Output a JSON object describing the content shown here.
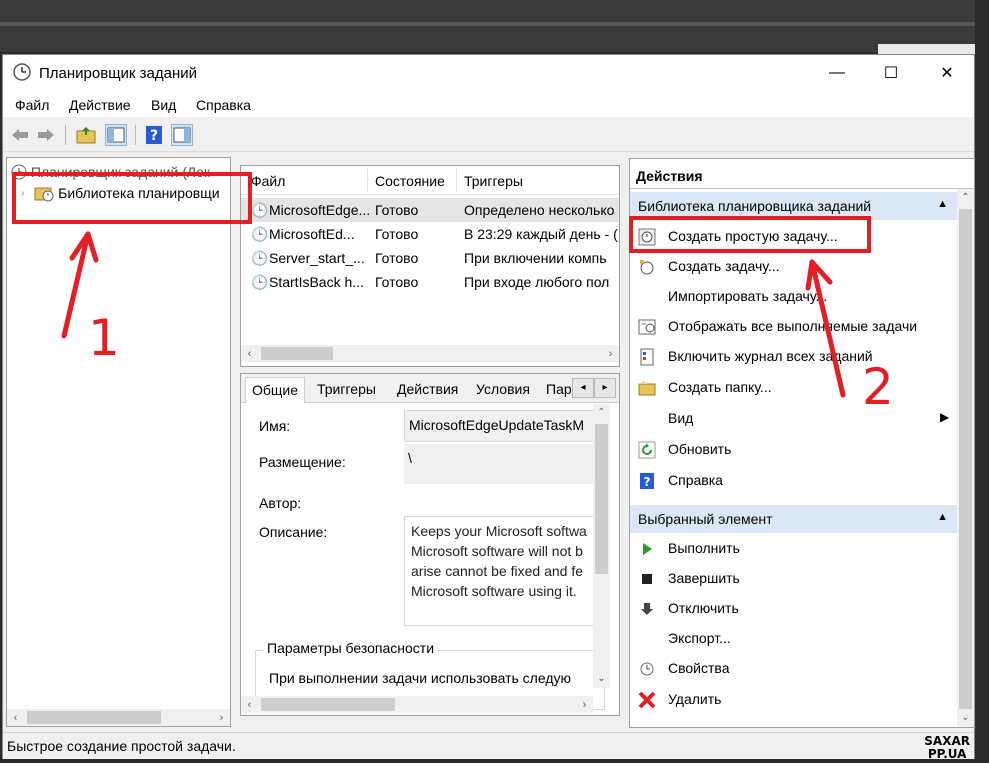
{
  "window": {
    "title": "Планировщик заданий",
    "minimize": "—",
    "maximize": "☐",
    "close": "✕"
  },
  "menu": [
    "Файл",
    "Действие",
    "Вид",
    "Справка"
  ],
  "tree": {
    "root": "Планировщик заданий (Лок",
    "library": "Библиотека планировщи"
  },
  "tasks": {
    "columns": [
      "Файл",
      "Состояние",
      "Триггеры"
    ],
    "rows": [
      {
        "name": "MicrosoftEdge...",
        "state": "Готово",
        "trigger": "Определено несколько"
      },
      {
        "name": "MicrosoftEd...",
        "state": "Готово",
        "trigger": "В 23:29 каждый день - ("
      },
      {
        "name": "Server_start_...",
        "state": "Готово",
        "trigger": "При включении компь"
      },
      {
        "name": "StartIsBack h...",
        "state": "Готово",
        "trigger": "При входе любого пол"
      }
    ]
  },
  "details": {
    "tabs": [
      "Общие",
      "Триггеры",
      "Действия",
      "Условия",
      "Пар"
    ],
    "name_label": "Имя:",
    "name_value": "MicrosoftEdgeUpdateTaskM",
    "location_label": "Размещение:",
    "location_value": "\\",
    "author_label": "Автор:",
    "description_label": "Описание:",
    "description_lines": [
      "Keeps your Microsoft softwa",
      "Microsoft software will not b",
      "arise cannot be fixed and fe",
      "Microsoft software using it."
    ],
    "security_group": "Параметры безопасности",
    "security_text": "При выполнении задачи использовать следую"
  },
  "actions": {
    "title": "Действия",
    "section1": "Библиотека планировщика заданий",
    "items1": [
      "Создать простую задачу...",
      "Создать задачу...",
      "Импортировать задачу...",
      "Отображать все выполняемые задачи",
      "Включить журнал всех заданий",
      "Создать папку...",
      "Вид",
      "Обновить",
      "Справка"
    ],
    "section2": "Выбранный элемент",
    "items2": [
      "Выполнить",
      "Завершить",
      "Отключить",
      "Экспорт...",
      "Свойства",
      "Удалить"
    ]
  },
  "status": "Быстрое создание простой задачи.",
  "watermark": [
    "SAXAR",
    "PP.UA"
  ],
  "annotations": [
    "1",
    "2"
  ]
}
